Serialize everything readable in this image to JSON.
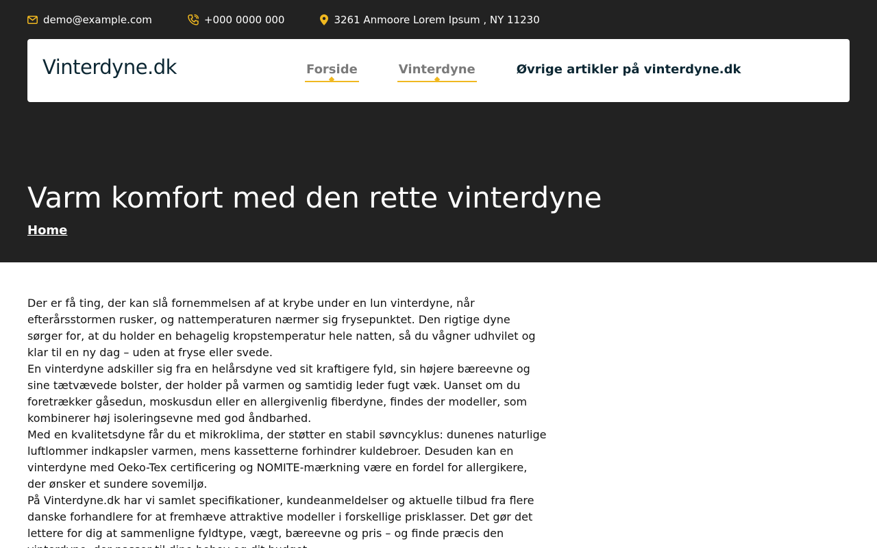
{
  "topbar": {
    "email": "demo@example.com",
    "phone": "+000 0000 000",
    "address": "3261 Anmoore Lorem Ipsum , NY 11230"
  },
  "brand": "Vinterdyne.dk",
  "nav": {
    "items": [
      {
        "label": "Forside"
      },
      {
        "label": "Vinterdyne"
      },
      {
        "label": "Øvrige artikler på vinterdyne.dk"
      }
    ]
  },
  "page": {
    "title": "Varm komfort med den rette vinterdyne",
    "breadcrumb": "Home"
  },
  "article": {
    "paragraphs": [
      "Der er få ting, der kan slå fornemmelsen af at krybe under en lun vinterdyne, når efterårsstormen rusker, og nattemperaturen nærmer sig frysepunktet. Den rigtige dyne sørger for, at du holder en behagelig kropstemperatur hele natten, så du vågner udhvilet og klar til en ny dag – uden at fryse eller svede.",
      "En vinterdyne adskiller sig fra en helårsdyne ved sit kraftigere fyld, sin højere bæreevne og sine tætvævede bolster, der holder på varmen og samtidig leder fugt væk. Uanset om du foretrækker gåsedun, moskusdun eller en allergivenlig fiberdyne, findes der modeller, som kombinerer høj isoleringsevne med god åndbarhed.",
      "Med en kvalitetsdyne får du et mikroklima, der støtter en stabil søvncyklus: dunenes naturlige luftlommer indkapsler varmen, mens kassetterne forhindrer kuldebroer. Desuden kan en vinterdyne med Oeko-Tex certificering og NOMITE-mærkning være en fordel for allergikere, der ønsker et sundere sovemiljø.",
      "På Vinterdyne.dk har vi samlet specifikationer, kundeanmeldelser og aktuelle tilbud fra flere danske forhandlere for at fremhæve attraktive modeller i forskellige prisklasser. Det gør det lettere for dig at sammenligne fyldtype, vægt, bæreevne og pris – og finde præcis den vinterdyne, der passer til dine behov og dit budget."
    ]
  },
  "colors": {
    "hero_bg": "#222222",
    "accent": "#f0b820",
    "brand_text": "#0c2733"
  }
}
